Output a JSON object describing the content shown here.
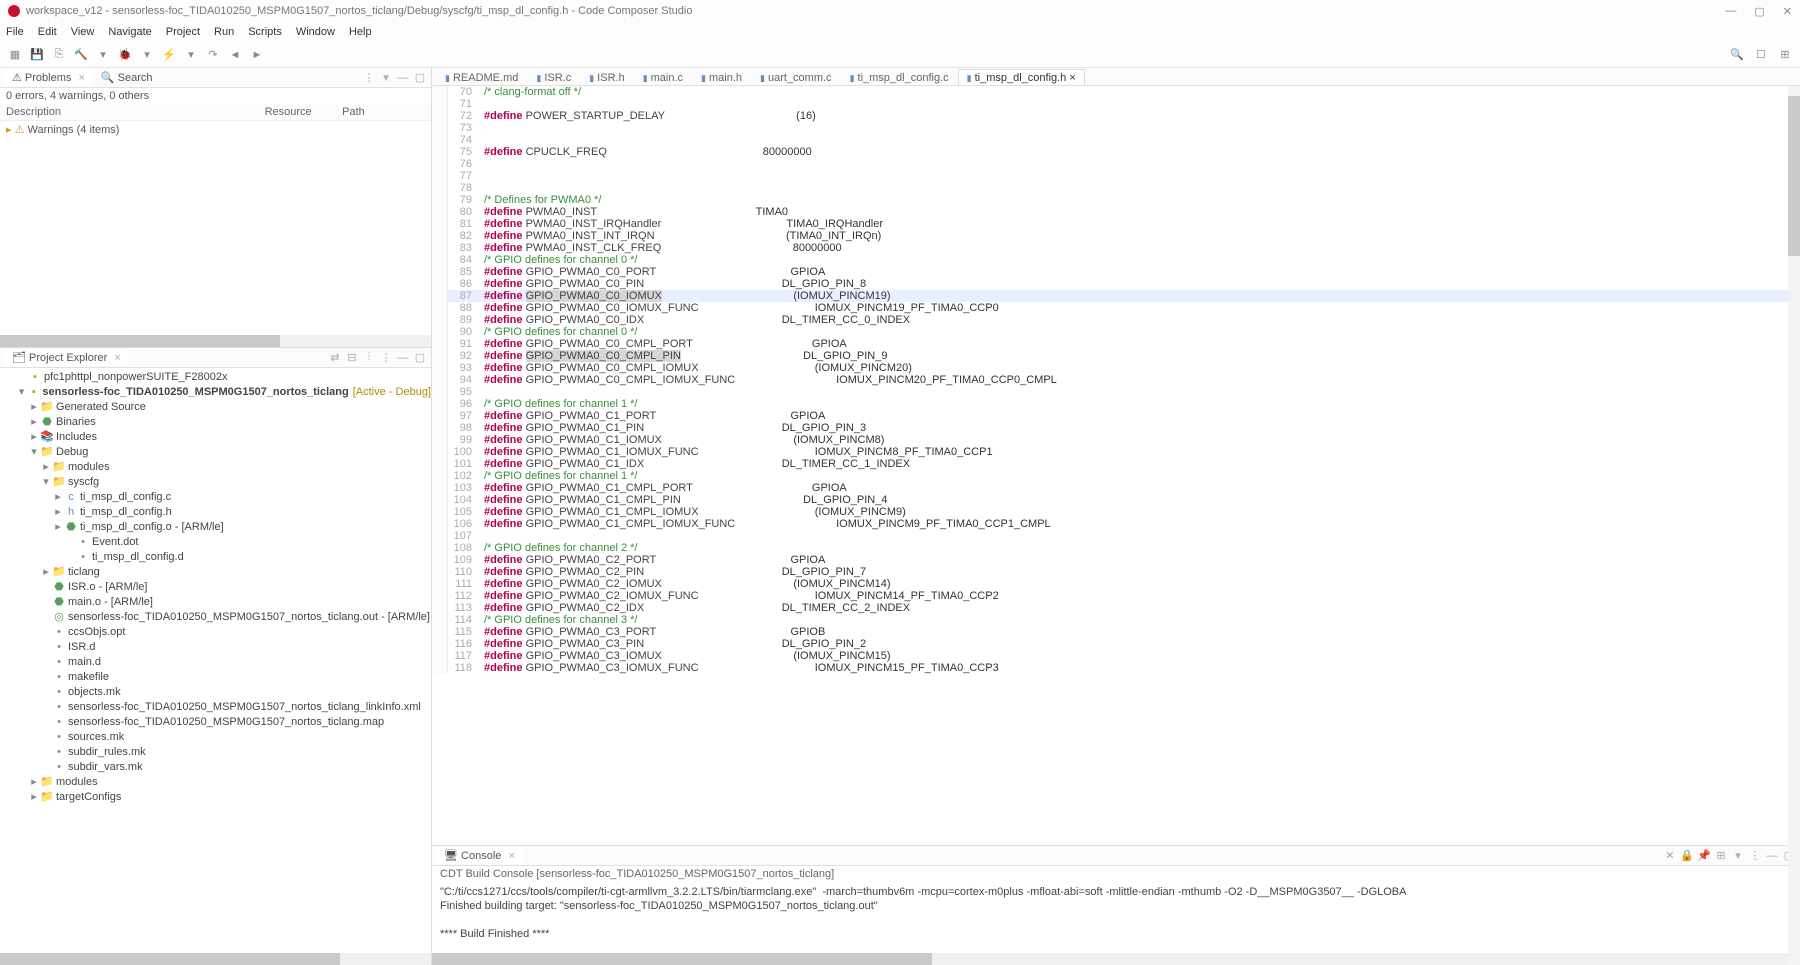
{
  "title_bar": {
    "text": "workspace_v12 - sensorless-foc_TIDA010250_MSPM0G1507_nortos_ticlang/Debug/syscfg/ti_msp_dl_config.h - Code Composer Studio"
  },
  "window_controls": {
    "min": "—",
    "max": "▢",
    "close": "✕"
  },
  "menu": [
    "File",
    "Edit",
    "View",
    "Navigate",
    "Project",
    "Run",
    "Scripts",
    "Window",
    "Help"
  ],
  "toolbar_right_icons": [
    "search-icon",
    "open-perspective-icon",
    "ccs-perspective-icon"
  ],
  "left_top_tabs": {
    "problems": "Problems",
    "search": "Search"
  },
  "problems_summary": "0 errors, 4 warnings, 0 others",
  "problems_cols": {
    "description": "Description",
    "resource": "Resource",
    "path": "Path"
  },
  "problems_first_row": "Warnings (4 items)",
  "project_tab": "Project Explorer",
  "project_tree": {
    "proj1": "pfc1phttpl_nonpowerSUITE_F28002x",
    "proj2_name": "sensorless-foc_TIDA010250_MSPM0G1507_nortos_ticlang",
    "proj2_suffix": "[Active - Debug]",
    "gen_src": "Generated Source",
    "binaries": "Binaries",
    "includes": "Includes",
    "debug": "Debug",
    "modules": "modules",
    "syscfg": "syscfg",
    "f1": "ti_msp_dl_config.c",
    "f2": "ti_msp_dl_config.h",
    "f3": "ti_msp_dl_config.o - [ARM/le]",
    "f4": "Event.dot",
    "f5": "ti_msp_dl_config.d",
    "ticlang": "ticlang",
    "isr_o": "ISR.o - [ARM/le]",
    "main_o": "main.o - [ARM/le]",
    "out_file": "sensorless-foc_TIDA010250_MSPM0G1507_nortos_ticlang.out - [ARM/le]",
    "ccsobjs": "ccsObjs.opt",
    "isr_d": "ISR.d",
    "main_d": "main.d",
    "makefile": "makefile",
    "objects_mk": "objects.mk",
    "linkinfo": "sensorless-foc_TIDA010250_MSPM0G1507_nortos_ticlang_linkInfo.xml",
    "mapfile": "sensorless-foc_TIDA010250_MSPM0G1507_nortos_ticlang.map",
    "sources_mk": "sources.mk",
    "subdir_rules": "subdir_rules.mk",
    "subdir_vars": "subdir_vars.mk",
    "modules2": "modules",
    "target_configs": "targetConfigs"
  },
  "editor_tabs": [
    {
      "label": "README.md"
    },
    {
      "label": "ISR.c"
    },
    {
      "label": "ISR.h"
    },
    {
      "label": "main.c"
    },
    {
      "label": "main.h"
    },
    {
      "label": "uart_comm.c"
    },
    {
      "label": "ti_msp_dl_config.c"
    },
    {
      "label": "ti_msp_dl_config.h",
      "active": true
    }
  ],
  "code_lines": [
    {
      "n": 70,
      "type": "comment",
      "text": "/* clang-format off */"
    },
    {
      "n": 71,
      "type": "blank"
    },
    {
      "n": 72,
      "type": "define",
      "name": "POWER_STARTUP_DELAY",
      "value": "(16)"
    },
    {
      "n": 73,
      "type": "blank"
    },
    {
      "n": 74,
      "type": "blank"
    },
    {
      "n": 75,
      "type": "define",
      "name": "CPUCLK_FREQ",
      "value": "80000000"
    },
    {
      "n": 76,
      "type": "blank"
    },
    {
      "n": 77,
      "type": "blank"
    },
    {
      "n": 78,
      "type": "blank"
    },
    {
      "n": 79,
      "type": "comment",
      "text": "/* Defines for PWMA0 */"
    },
    {
      "n": 80,
      "type": "define",
      "name": "PWMA0_INST",
      "value": "TIMA0"
    },
    {
      "n": 81,
      "type": "define",
      "name": "PWMA0_INST_IRQHandler",
      "value": "TIMA0_IRQHandler"
    },
    {
      "n": 82,
      "type": "define",
      "name": "PWMA0_INST_INT_IRQN",
      "value": "(TIMA0_INT_IRQn)"
    },
    {
      "n": 83,
      "type": "define",
      "name": "PWMA0_INST_CLK_FREQ",
      "value": "80000000"
    },
    {
      "n": 84,
      "type": "comment",
      "text": "/* GPIO defines for channel 0 */"
    },
    {
      "n": 85,
      "type": "define",
      "name": "GPIO_PWMA0_C0_PORT",
      "value": "GPIOA"
    },
    {
      "n": 86,
      "type": "define",
      "name": "GPIO_PWMA0_C0_PIN",
      "value": "DL_GPIO_PIN_8"
    },
    {
      "n": 87,
      "type": "define",
      "name": "GPIO_PWMA0_C0_IOMUX",
      "value": "(IOMUX_PINCM19)",
      "hl": true,
      "name_sel": true
    },
    {
      "n": 88,
      "type": "define",
      "name": "GPIO_PWMA0_C0_IOMUX_FUNC",
      "value": "IOMUX_PINCM19_PF_TIMA0_CCP0"
    },
    {
      "n": 89,
      "type": "define",
      "name": "GPIO_PWMA0_C0_IDX",
      "value": "DL_TIMER_CC_0_INDEX"
    },
    {
      "n": 90,
      "type": "comment",
      "text": "/* GPIO defines for channel 0 */"
    },
    {
      "n": 91,
      "type": "define",
      "name": "GPIO_PWMA0_C0_CMPL_PORT",
      "value": "GPIOA"
    },
    {
      "n": 92,
      "type": "define",
      "name": "GPIO_PWMA0_C0_CMPL_PIN",
      "value": "DL_GPIO_PIN_9",
      "name_sel": true
    },
    {
      "n": 93,
      "type": "define",
      "name": "GPIO_PWMA0_C0_CMPL_IOMUX",
      "value": "(IOMUX_PINCM20)"
    },
    {
      "n": 94,
      "type": "define",
      "name": "GPIO_PWMA0_C0_CMPL_IOMUX_FUNC",
      "value": "IOMUX_PINCM20_PF_TIMA0_CCP0_CMPL"
    },
    {
      "n": 95,
      "type": "blank"
    },
    {
      "n": 96,
      "type": "comment",
      "text": "/* GPIO defines for channel 1 */"
    },
    {
      "n": 97,
      "type": "define",
      "name": "GPIO_PWMA0_C1_PORT",
      "value": "GPIOA"
    },
    {
      "n": 98,
      "type": "define",
      "name": "GPIO_PWMA0_C1_PIN",
      "value": "DL_GPIO_PIN_3"
    },
    {
      "n": 99,
      "type": "define",
      "name": "GPIO_PWMA0_C1_IOMUX",
      "value": "(IOMUX_PINCM8)"
    },
    {
      "n": 100,
      "type": "define",
      "name": "GPIO_PWMA0_C1_IOMUX_FUNC",
      "value": "IOMUX_PINCM8_PF_TIMA0_CCP1"
    },
    {
      "n": 101,
      "type": "define",
      "name": "GPIO_PWMA0_C1_IDX",
      "value": "DL_TIMER_CC_1_INDEX"
    },
    {
      "n": 102,
      "type": "comment",
      "text": "/* GPIO defines for channel 1 */"
    },
    {
      "n": 103,
      "type": "define",
      "name": "GPIO_PWMA0_C1_CMPL_PORT",
      "value": "GPIOA"
    },
    {
      "n": 104,
      "type": "define",
      "name": "GPIO_PWMA0_C1_CMPL_PIN",
      "value": "DL_GPIO_PIN_4"
    },
    {
      "n": 105,
      "type": "define",
      "name": "GPIO_PWMA0_C1_CMPL_IOMUX",
      "value": "(IOMUX_PINCM9)"
    },
    {
      "n": 106,
      "type": "define",
      "name": "GPIO_PWMA0_C1_CMPL_IOMUX_FUNC",
      "value": "IOMUX_PINCM9_PF_TIMA0_CCP1_CMPL"
    },
    {
      "n": 107,
      "type": "blank"
    },
    {
      "n": 108,
      "type": "comment",
      "text": "/* GPIO defines for channel 2 */"
    },
    {
      "n": 109,
      "type": "define",
      "name": "GPIO_PWMA0_C2_PORT",
      "value": "GPIOA"
    },
    {
      "n": 110,
      "type": "define",
      "name": "GPIO_PWMA0_C2_PIN",
      "value": "DL_GPIO_PIN_7"
    },
    {
      "n": 111,
      "type": "define",
      "name": "GPIO_PWMA0_C2_IOMUX",
      "value": "(IOMUX_PINCM14)"
    },
    {
      "n": 112,
      "type": "define",
      "name": "GPIO_PWMA0_C2_IOMUX_FUNC",
      "value": "IOMUX_PINCM14_PF_TIMA0_CCP2"
    },
    {
      "n": 113,
      "type": "define",
      "name": "GPIO_PWMA0_C2_IDX",
      "value": "DL_TIMER_CC_2_INDEX"
    },
    {
      "n": 114,
      "type": "comment",
      "text": "/* GPIO defines for channel 3 */"
    },
    {
      "n": 115,
      "type": "define",
      "name": "GPIO_PWMA0_C3_PORT",
      "value": "GPIOB"
    },
    {
      "n": 116,
      "type": "define",
      "name": "GPIO_PWMA0_C3_PIN",
      "value": "DL_GPIO_PIN_2"
    },
    {
      "n": 117,
      "type": "define",
      "name": "GPIO_PWMA0_C3_IOMUX",
      "value": "(IOMUX_PINCM15)"
    },
    {
      "n": 118,
      "type": "define",
      "name": "GPIO_PWMA0_C3_IOMUX_FUNC",
      "value": "IOMUX_PINCM15_PF_TIMA0_CCP3"
    }
  ],
  "console": {
    "tab": "Console",
    "head": "CDT Build Console [sensorless-foc_TIDA010250_MSPM0G1507_nortos_ticlang]",
    "line1": "\"C:/ti/ccs1271/ccs/tools/compiler/ti-cgt-armllvm_3.2.2.LTS/bin/tiarmclang.exe\"  -march=thumbv6m -mcpu=cortex-m0plus -mfloat-abi=soft -mlittle-endian -mthumb -O2 -D__MSPM0G3507__ -DGLOBA",
    "line2": "Finished building target: \"sensorless-foc_TIDA010250_MSPM0G1507_nortos_ticlang.out\"",
    "line3": "",
    "line4": "**** Build Finished ****"
  }
}
